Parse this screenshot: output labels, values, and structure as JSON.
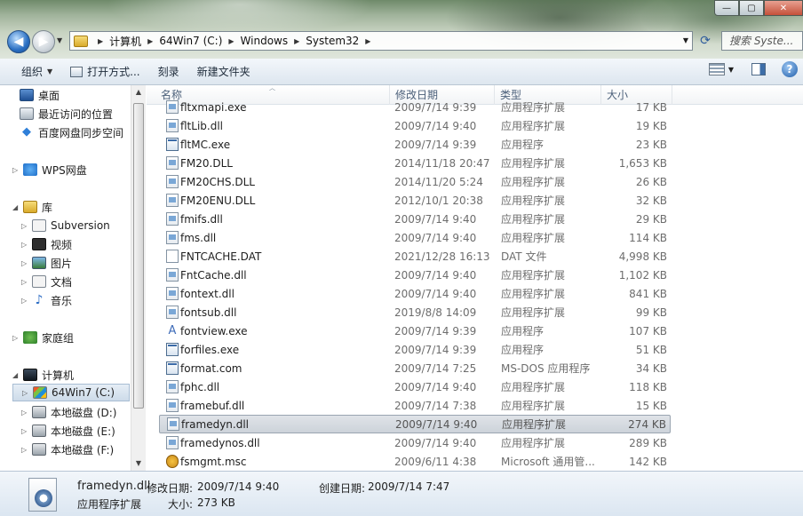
{
  "window": {
    "min_label": "—",
    "max_label": "▢",
    "close_label": "✕"
  },
  "address": {
    "crumbs": [
      "计算机",
      "64Win7 (C:)",
      "Windows",
      "System32"
    ],
    "search_placeholder": "搜索 Syste..."
  },
  "toolbar": {
    "organize": "组织",
    "open_with": "打开方式...",
    "burn": "刻录",
    "new_folder": "新建文件夹"
  },
  "navpane": {
    "desktop": "桌面",
    "recent": "最近访问的位置",
    "baidu": "百度网盘同步空间",
    "wps": "WPS网盘",
    "library": "库",
    "subversion": "Subversion",
    "video": "视频",
    "pictures": "图片",
    "documents": "文档",
    "music": "音乐",
    "homegroup": "家庭组",
    "computer": "计算机",
    "drive_c": "64Win7  (C:)",
    "drive_d": "本地磁盘 (D:)",
    "drive_e": "本地磁盘 (E:)",
    "drive_f": "本地磁盘 (F:)"
  },
  "columns": {
    "name": "名称",
    "date": "修改日期",
    "type": "类型",
    "size": "大小"
  },
  "files": [
    {
      "name": "fltxmapi.exe",
      "date": "2009/7/14 9:39",
      "type": "应用程序扩展",
      "size": "17 KB",
      "icon": "dll"
    },
    {
      "name": "fltLib.dll",
      "date": "2009/7/14 9:40",
      "type": "应用程序扩展",
      "size": "19 KB",
      "icon": "dll"
    },
    {
      "name": "fltMC.exe",
      "date": "2009/7/14 9:39",
      "type": "应用程序",
      "size": "23 KB",
      "icon": "exe"
    },
    {
      "name": "FM20.DLL",
      "date": "2014/11/18 20:47",
      "type": "应用程序扩展",
      "size": "1,653 KB",
      "icon": "dll"
    },
    {
      "name": "FM20CHS.DLL",
      "date": "2014/11/20 5:24",
      "type": "应用程序扩展",
      "size": "26 KB",
      "icon": "dll"
    },
    {
      "name": "FM20ENU.DLL",
      "date": "2012/10/1 20:38",
      "type": "应用程序扩展",
      "size": "32 KB",
      "icon": "dll"
    },
    {
      "name": "fmifs.dll",
      "date": "2009/7/14 9:40",
      "type": "应用程序扩展",
      "size": "29 KB",
      "icon": "dll"
    },
    {
      "name": "fms.dll",
      "date": "2009/7/14 9:40",
      "type": "应用程序扩展",
      "size": "114 KB",
      "icon": "dll"
    },
    {
      "name": "FNTCACHE.DAT",
      "date": "2021/12/28 16:13",
      "type": "DAT 文件",
      "size": "4,998 KB",
      "icon": "dat"
    },
    {
      "name": "FntCache.dll",
      "date": "2009/7/14 9:40",
      "type": "应用程序扩展",
      "size": "1,102 KB",
      "icon": "dll"
    },
    {
      "name": "fontext.dll",
      "date": "2009/7/14 9:40",
      "type": "应用程序扩展",
      "size": "841 KB",
      "icon": "dll"
    },
    {
      "name": "fontsub.dll",
      "date": "2019/8/8 14:09",
      "type": "应用程序扩展",
      "size": "99 KB",
      "icon": "dll"
    },
    {
      "name": "fontview.exe",
      "date": "2009/7/14 9:39",
      "type": "应用程序",
      "size": "107 KB",
      "icon": "fv"
    },
    {
      "name": "forfiles.exe",
      "date": "2009/7/14 9:39",
      "type": "应用程序",
      "size": "51 KB",
      "icon": "exe"
    },
    {
      "name": "format.com",
      "date": "2009/7/14 7:25",
      "type": "MS-DOS 应用程序",
      "size": "34 KB",
      "icon": "exe"
    },
    {
      "name": "fphc.dll",
      "date": "2009/7/14 9:40",
      "type": "应用程序扩展",
      "size": "118 KB",
      "icon": "dll"
    },
    {
      "name": "framebuf.dll",
      "date": "2009/7/14 7:38",
      "type": "应用程序扩展",
      "size": "15 KB",
      "icon": "dll"
    },
    {
      "name": "framedyn.dll",
      "date": "2009/7/14 9:40",
      "type": "应用程序扩展",
      "size": "274 KB",
      "icon": "dll",
      "selected": true
    },
    {
      "name": "framedynos.dll",
      "date": "2009/7/14 9:40",
      "type": "应用程序扩展",
      "size": "289 KB",
      "icon": "dll"
    },
    {
      "name": "fsmgmt.msc",
      "date": "2009/6/11 4:38",
      "type": "Microsoft 通用管...",
      "size": "142 KB",
      "icon": "msc"
    }
  ],
  "details": {
    "filename": "framedyn.dll",
    "filetype": "应用程序扩展",
    "modified_label": "修改日期:",
    "modified_value": "2009/7/14 9:40",
    "created_label": "创建日期:",
    "created_value": "2009/7/14 7:47",
    "size_label": "大小:",
    "size_value": "273 KB"
  }
}
